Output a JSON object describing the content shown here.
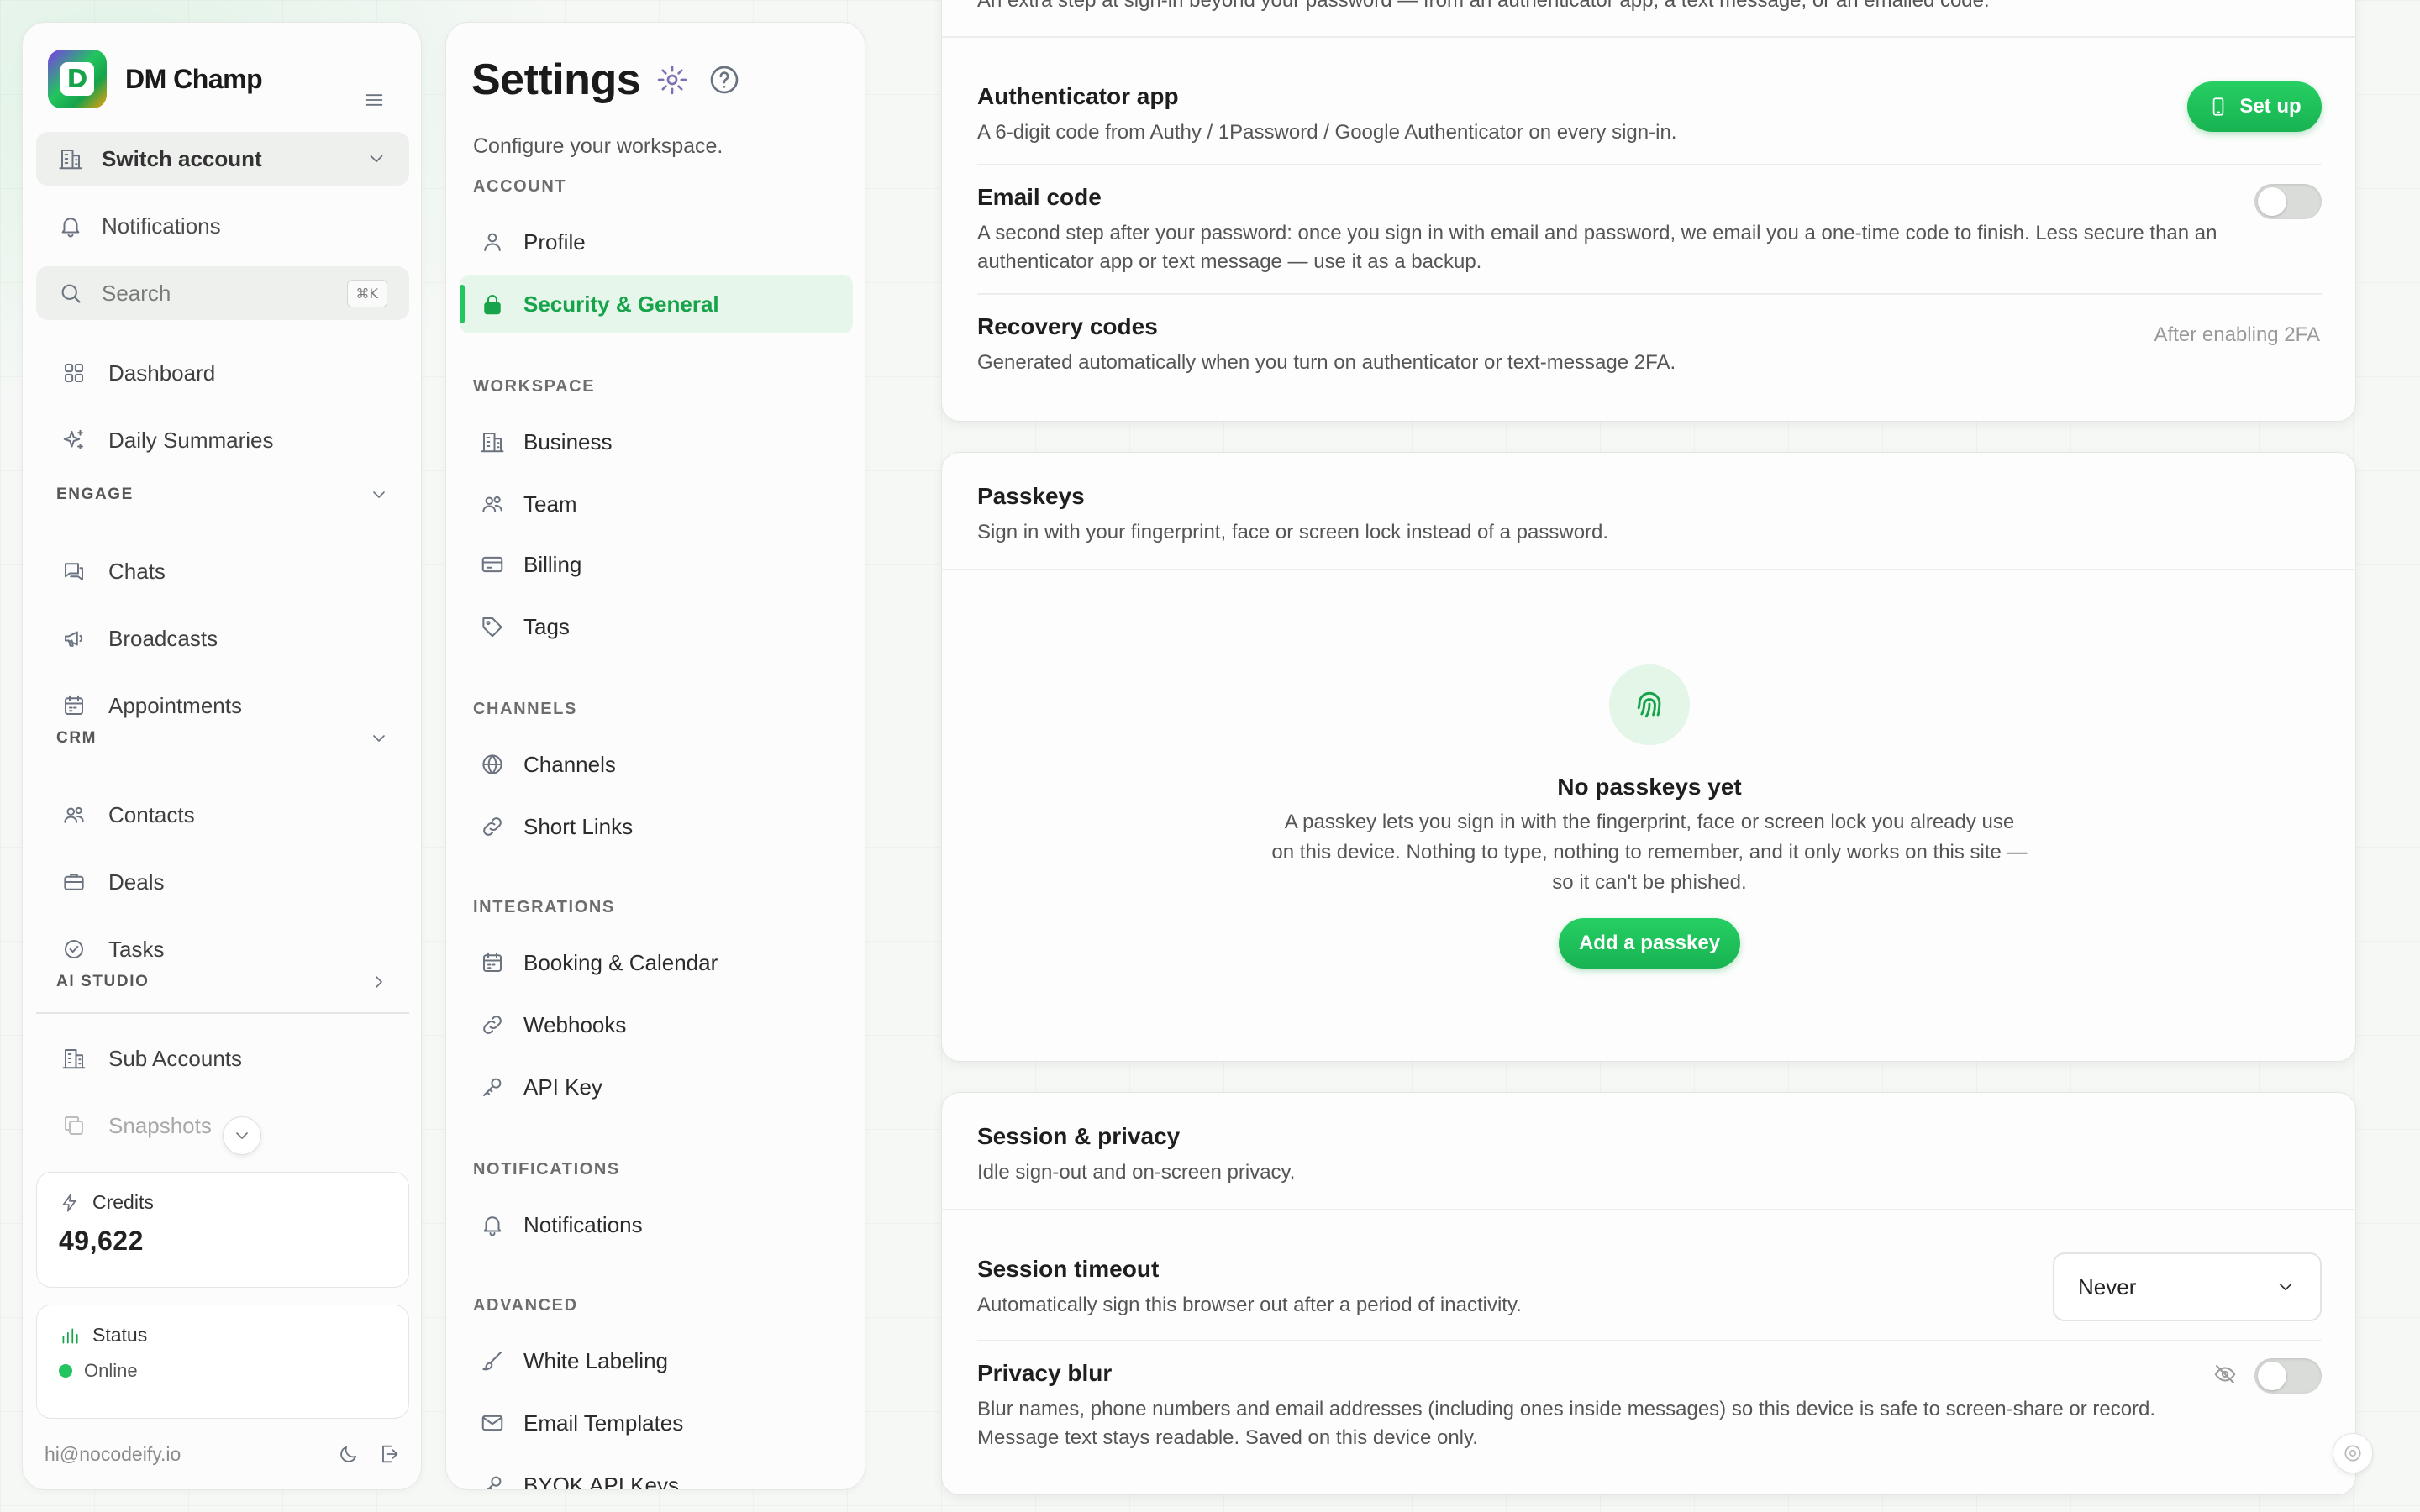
{
  "brand": {
    "logo_letter": "D",
    "name": "DM Champ"
  },
  "sidebar": {
    "switch_account": "Switch account",
    "notifications": "Notifications",
    "search": {
      "placeholder": "Search",
      "shortcut": "⌘K"
    },
    "items_top": [
      {
        "label": "Dashboard",
        "icon": "grid-icon"
      },
      {
        "label": "Daily Summaries",
        "icon": "sparkles-icon"
      }
    ],
    "sections": {
      "engage": "ENGAGE",
      "crm": "CRM",
      "ai_studio": "AI STUDIO"
    },
    "engage_items": [
      {
        "label": "Chats",
        "icon": "chat-icon"
      },
      {
        "label": "Broadcasts",
        "icon": "megaphone-icon"
      },
      {
        "label": "Appointments",
        "icon": "calendar-icon"
      }
    ],
    "crm_items": [
      {
        "label": "Contacts",
        "icon": "users-icon"
      },
      {
        "label": "Deals",
        "icon": "briefcase-icon"
      },
      {
        "label": "Tasks",
        "icon": "check-circle-icon"
      }
    ],
    "bottom_items": [
      {
        "label": "Sub Accounts",
        "icon": "building-icon"
      },
      {
        "label": "Snapshots",
        "icon": "copy-icon"
      }
    ],
    "credits": {
      "label": "Credits",
      "value": "49,622"
    },
    "status": {
      "label": "Status",
      "value": "Online",
      "color": "#22c55e"
    },
    "footer_email": "hi@nocodeify.io"
  },
  "settings": {
    "title": "Settings",
    "subtitle": "Configure your workspace.",
    "sections": {
      "account": "ACCOUNT",
      "workspace": "WORKSPACE",
      "channels": "CHANNELS",
      "integrations": "INTEGRATIONS",
      "notifications": "NOTIFICATIONS",
      "advanced": "ADVANCED"
    },
    "account_items": [
      "Profile",
      "Security & General"
    ],
    "workspace_items": [
      "Business",
      "Team",
      "Billing",
      "Tags"
    ],
    "channels_items": [
      "Channels",
      "Short Links"
    ],
    "integrations_items": [
      "Booking & Calendar",
      "Webhooks",
      "API Key"
    ],
    "notifications_items": [
      "Notifications"
    ],
    "advanced_items": [
      "White Labeling",
      "Email Templates",
      "BYOK API Keys"
    ],
    "active": "Security & General",
    "accent": "#16a34a"
  },
  "two_factor": {
    "intro": "An extra step at sign-in beyond your password — from an authenticator app, a text message, or an emailed code.",
    "authenticator": {
      "title": "Authenticator app",
      "desc": "A 6-digit code from Authy / 1Password / Google Authenticator on every sign-in.",
      "button": "Set up"
    },
    "email_code": {
      "title": "Email code",
      "desc": "A second step after your password: once you sign in with email and password, we email you a one-time code to finish. Less secure than an authenticator app or text message — use it as a backup.",
      "enabled": false
    },
    "recovery": {
      "title": "Recovery codes",
      "desc": "Generated automatically when you turn on authenticator or text-message 2FA.",
      "note": "After enabling 2FA"
    }
  },
  "passkeys": {
    "title": "Passkeys",
    "desc": "Sign in with your fingerprint, face or screen lock instead of a password.",
    "empty_title": "No passkeys yet",
    "empty_desc": "A passkey lets you sign in with the fingerprint, face or screen lock you already use on this device. Nothing to type, nothing to remember, and it only works on this site — so it can't be phished.",
    "button": "Add a passkey"
  },
  "session": {
    "title": "Session & privacy",
    "desc": "Idle sign-out and on-screen privacy.",
    "timeout": {
      "title": "Session timeout",
      "desc": "Automatically sign this browser out after a period of inactivity.",
      "value": "Never"
    },
    "privacy_blur": {
      "title": "Privacy blur",
      "desc": "Blur names, phone numbers and email addresses (including ones inside messages) so this device is safe to screen-share or record. Message text stays readable. Saved on this device only.",
      "enabled": false
    }
  }
}
